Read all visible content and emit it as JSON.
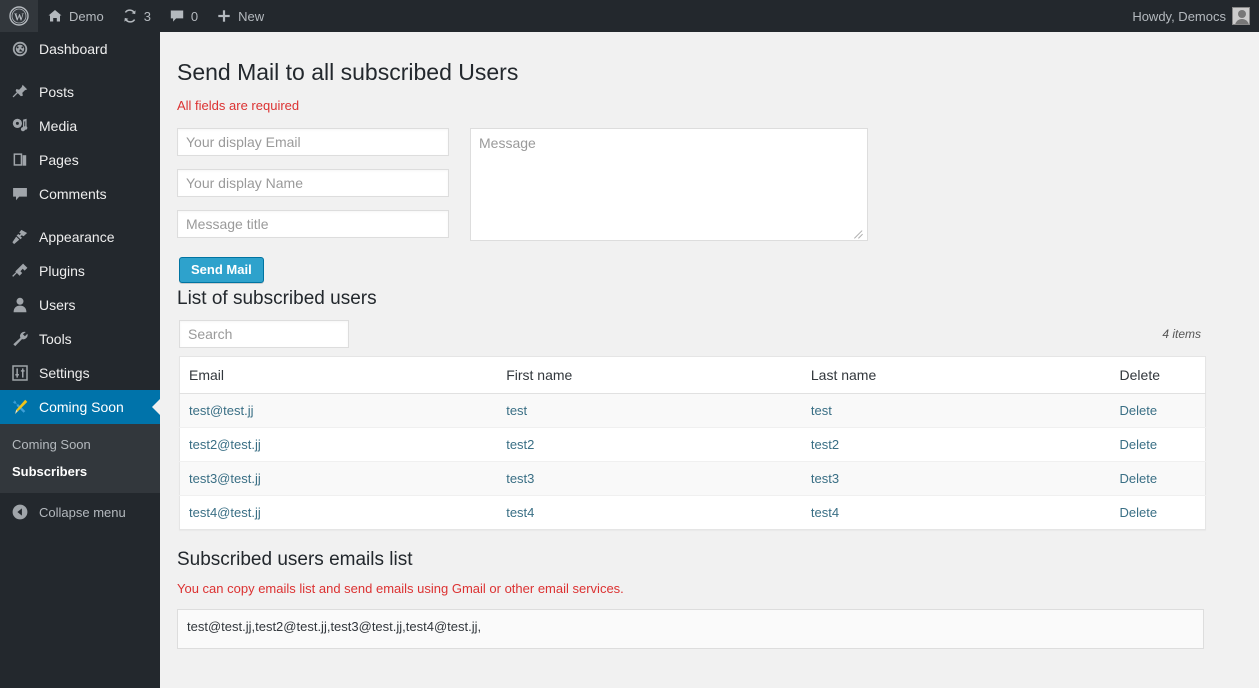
{
  "adminbar": {
    "logo_icon": "wordpress-logo-icon",
    "site": {
      "label": "Demo",
      "icon": "home-icon"
    },
    "updates": {
      "count": "3",
      "icon": "updates-icon"
    },
    "comments": {
      "count": "0",
      "icon": "comment-bubble-icon"
    },
    "new": {
      "label": "New",
      "icon": "plus-icon"
    },
    "account": {
      "label": "Howdy, Democs",
      "icon": "avatar-icon"
    }
  },
  "sidebar": {
    "items": [
      {
        "label": "Dashboard",
        "icon": "dashboard-icon",
        "current": false
      },
      {
        "label": "Posts",
        "icon": "pin-icon",
        "current": false
      },
      {
        "label": "Media",
        "icon": "media-icon",
        "current": false
      },
      {
        "label": "Pages",
        "icon": "pages-icon",
        "current": false
      },
      {
        "label": "Comments",
        "icon": "comment-bubble-icon",
        "current": false
      },
      {
        "label": "Appearance",
        "icon": "brush-icon",
        "current": false
      },
      {
        "label": "Plugins",
        "icon": "plug-icon",
        "current": false
      },
      {
        "label": "Users",
        "icon": "user-icon",
        "current": false
      },
      {
        "label": "Tools",
        "icon": "wrench-icon",
        "current": false
      },
      {
        "label": "Settings",
        "icon": "settings-sliders-icon",
        "current": false
      },
      {
        "label": "Coming Soon",
        "icon": "tools-pencil-icon",
        "current": true
      }
    ],
    "submenu": [
      {
        "label": "Coming Soon",
        "current": false
      },
      {
        "label": "Subscribers",
        "current": true
      }
    ],
    "collapse": {
      "label": "Collapse menu",
      "icon": "collapse-arrow-icon"
    }
  },
  "mail_form": {
    "title": "Send Mail to all subscribed Users",
    "required_note": "All fields are required",
    "email_placeholder": "Your display Email",
    "email_value": "",
    "name_placeholder": "Your display Name",
    "name_value": "",
    "subject_placeholder": "Message title",
    "subject_value": "",
    "message_placeholder": "Message",
    "message_value": "",
    "submit_label": "Send Mail"
  },
  "list": {
    "title": "List of subscribed users",
    "search_placeholder": "Search",
    "search_value": "",
    "items_count": "4 items",
    "columns": [
      "Email",
      "First name",
      "Last name",
      "Delete"
    ],
    "rows": [
      {
        "email": "test@test.jj",
        "first": "test",
        "last": "test",
        "delete": "Delete"
      },
      {
        "email": "test2@test.jj",
        "first": "test2",
        "last": "test2",
        "delete": "Delete"
      },
      {
        "email": "test3@test.jj",
        "first": "test3",
        "last": "test3",
        "delete": "Delete"
      },
      {
        "email": "test4@test.jj",
        "first": "test4",
        "last": "test4",
        "delete": "Delete"
      }
    ]
  },
  "emails_section": {
    "title": "Subscribed users emails list",
    "note": "You can copy emails list and send emails using Gmail or other email services.",
    "value": "test@test.jj,test2@test.jj,test3@test.jj,test4@test.jj,"
  },
  "colors": {
    "adminbar_bg": "#23282d",
    "sidebar_bg": "#23282d",
    "submenu_bg": "#32373c",
    "active_blue": "#0073aa",
    "button_blue": "#2ea2cc",
    "link_blue": "#3a6f85",
    "warning_red": "#dc3232",
    "page_bg": "#f1f1f1"
  }
}
